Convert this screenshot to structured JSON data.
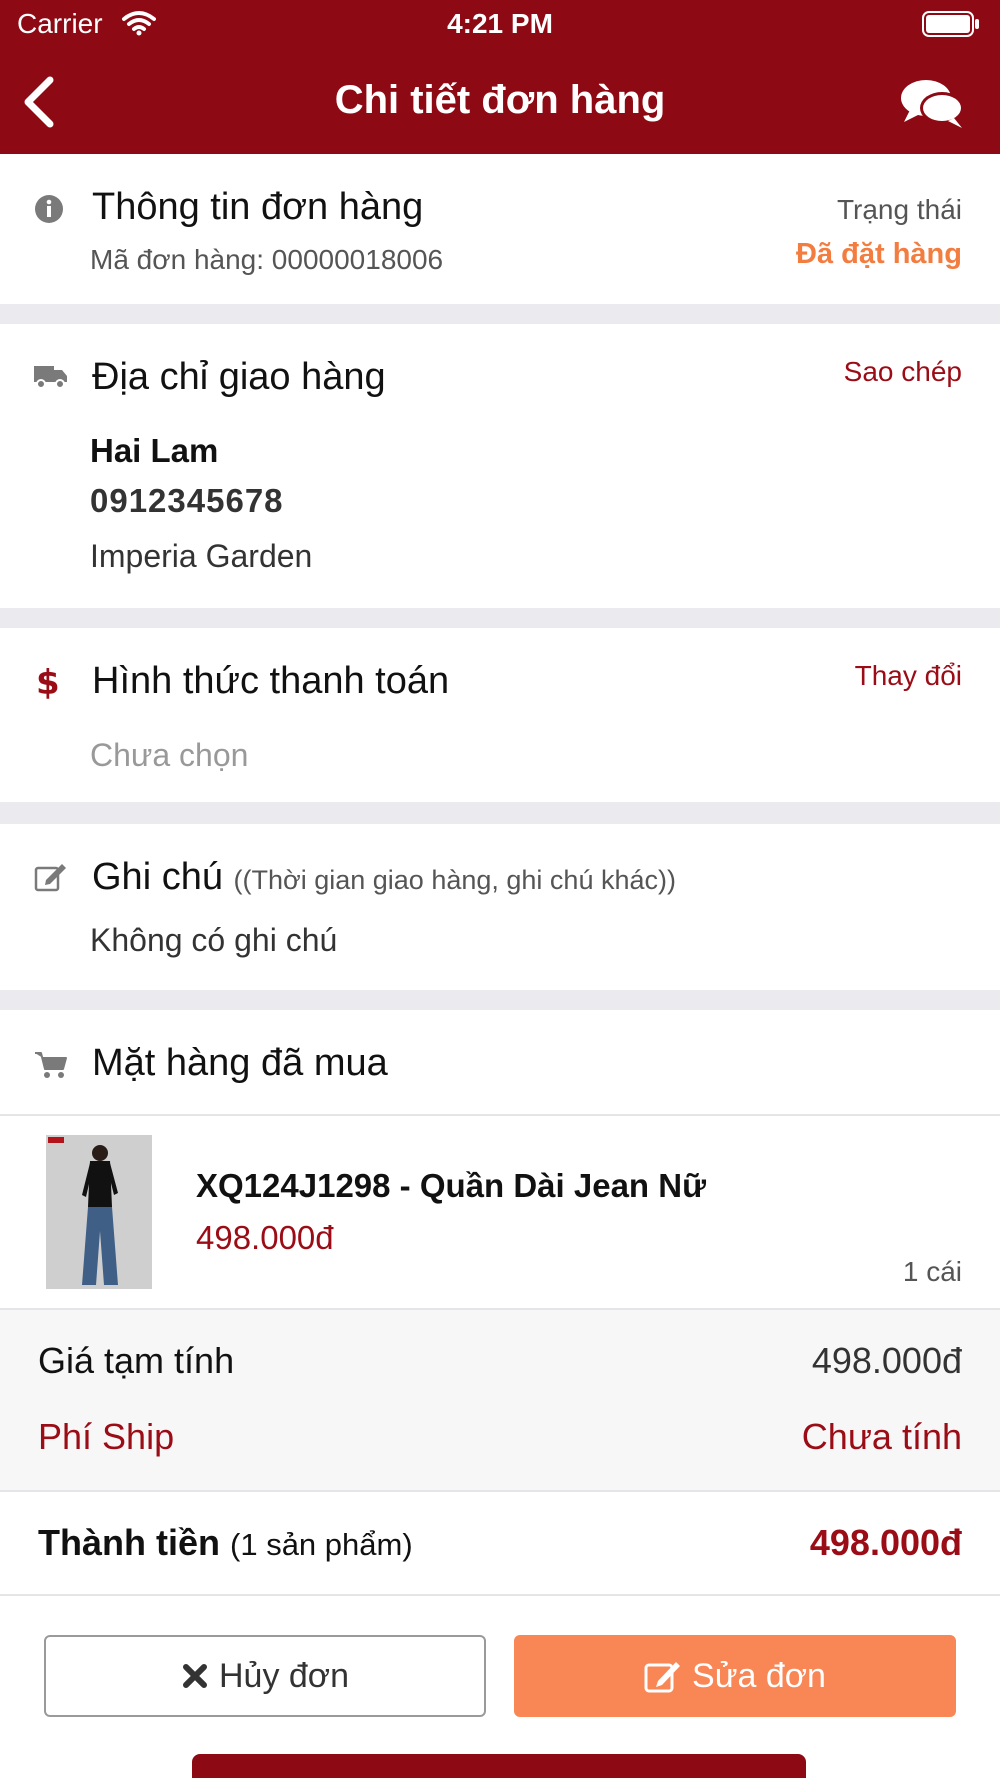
{
  "status_bar": {
    "carrier": "Carrier",
    "time": "4:21 PM"
  },
  "nav": {
    "title": "Chi tiết đơn hàng"
  },
  "order_info": {
    "title": "Thông tin đơn hàng",
    "order_code": "Mã đơn hàng: 00000018006",
    "status_label": "Trạng thái",
    "status_value": "Đã đặt hàng"
  },
  "shipping": {
    "title": "Địa chỉ giao hàng",
    "copy_label": "Sao chép",
    "name": "Hai Lam",
    "phone": "0912345678",
    "address": "Imperia Garden"
  },
  "payment": {
    "title": "Hình thức thanh toán",
    "change_label": "Thay đổi",
    "value": "Chưa chọn"
  },
  "note": {
    "title": "Ghi chú",
    "hint": "((Thời gian giao hàng, ghi chú khác))",
    "value": "Không có ghi chú"
  },
  "items": {
    "title": "Mặt hàng đã mua",
    "list": [
      {
        "name": "XQ124J1298 - Quần Dài Jean Nữ",
        "price": "498.000đ",
        "qty": "1 cái"
      }
    ]
  },
  "summary": {
    "subtotal_label": "Giá tạm tính",
    "subtotal_value": "498.000đ",
    "ship_label": "Phí Ship",
    "ship_value": "Chưa tính",
    "total_label": "Thành tiền",
    "total_count": "(1 sản phẩm)",
    "total_value": "498.000đ"
  },
  "actions": {
    "cancel_label": "Hủy đơn",
    "edit_label": "Sửa đơn"
  },
  "colors": {
    "brand": "#8d0a14",
    "accent_orange": "#f98655",
    "status_orange": "#f37c3f",
    "price_red": "#9a0c16"
  },
  "icons": [
    "back-icon",
    "chat-icon",
    "info-icon",
    "truck-icon",
    "dollar-icon",
    "edit-icon",
    "cart-icon",
    "close-icon"
  ]
}
